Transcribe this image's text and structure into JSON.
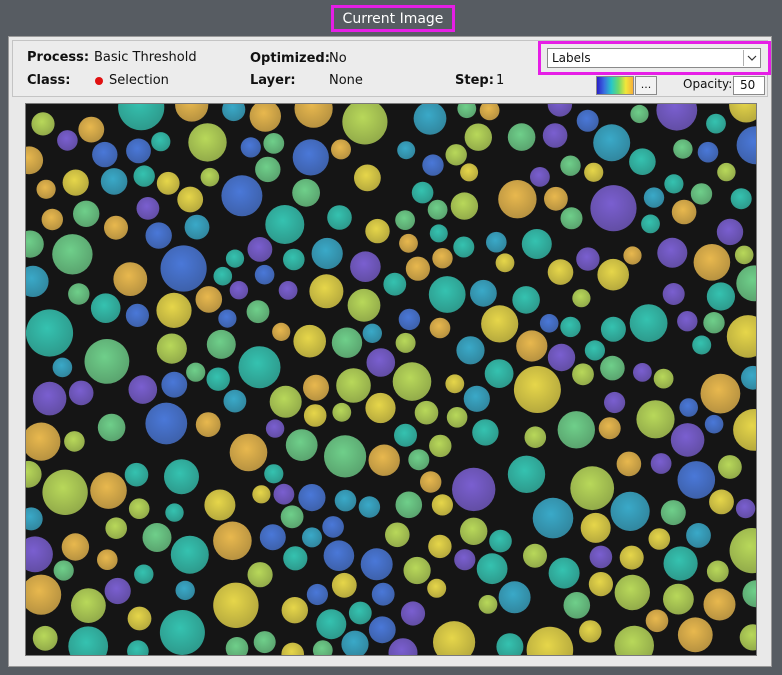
{
  "header": {
    "title": "Current Image"
  },
  "info": {
    "process_label": "Process:",
    "process_value": "Basic Threshold",
    "optimized_label": "Optimized:",
    "optimized_value": "No",
    "class_label": "Class:",
    "class_value": "Selection",
    "class_color": "#e01010",
    "layer_label": "Layer:",
    "layer_value": "None",
    "step_label": "Step:",
    "step_value": "1"
  },
  "controls": {
    "overlay_select_value": "Labels",
    "more_button_label": "...",
    "opacity_label": "Opacity:",
    "opacity_value": "50"
  },
  "colors": {
    "highlight": "#e61ee6",
    "background": "#575c62",
    "image_bg": "#151515",
    "label_palette": [
      "#7a5fd0",
      "#4a78d8",
      "#3aa9c8",
      "#35c2b0",
      "#6fcf8a",
      "#b8d85a",
      "#e6d64a",
      "#e8b84e"
    ]
  },
  "image": {
    "name": "segmented-particles-label-overlay"
  }
}
